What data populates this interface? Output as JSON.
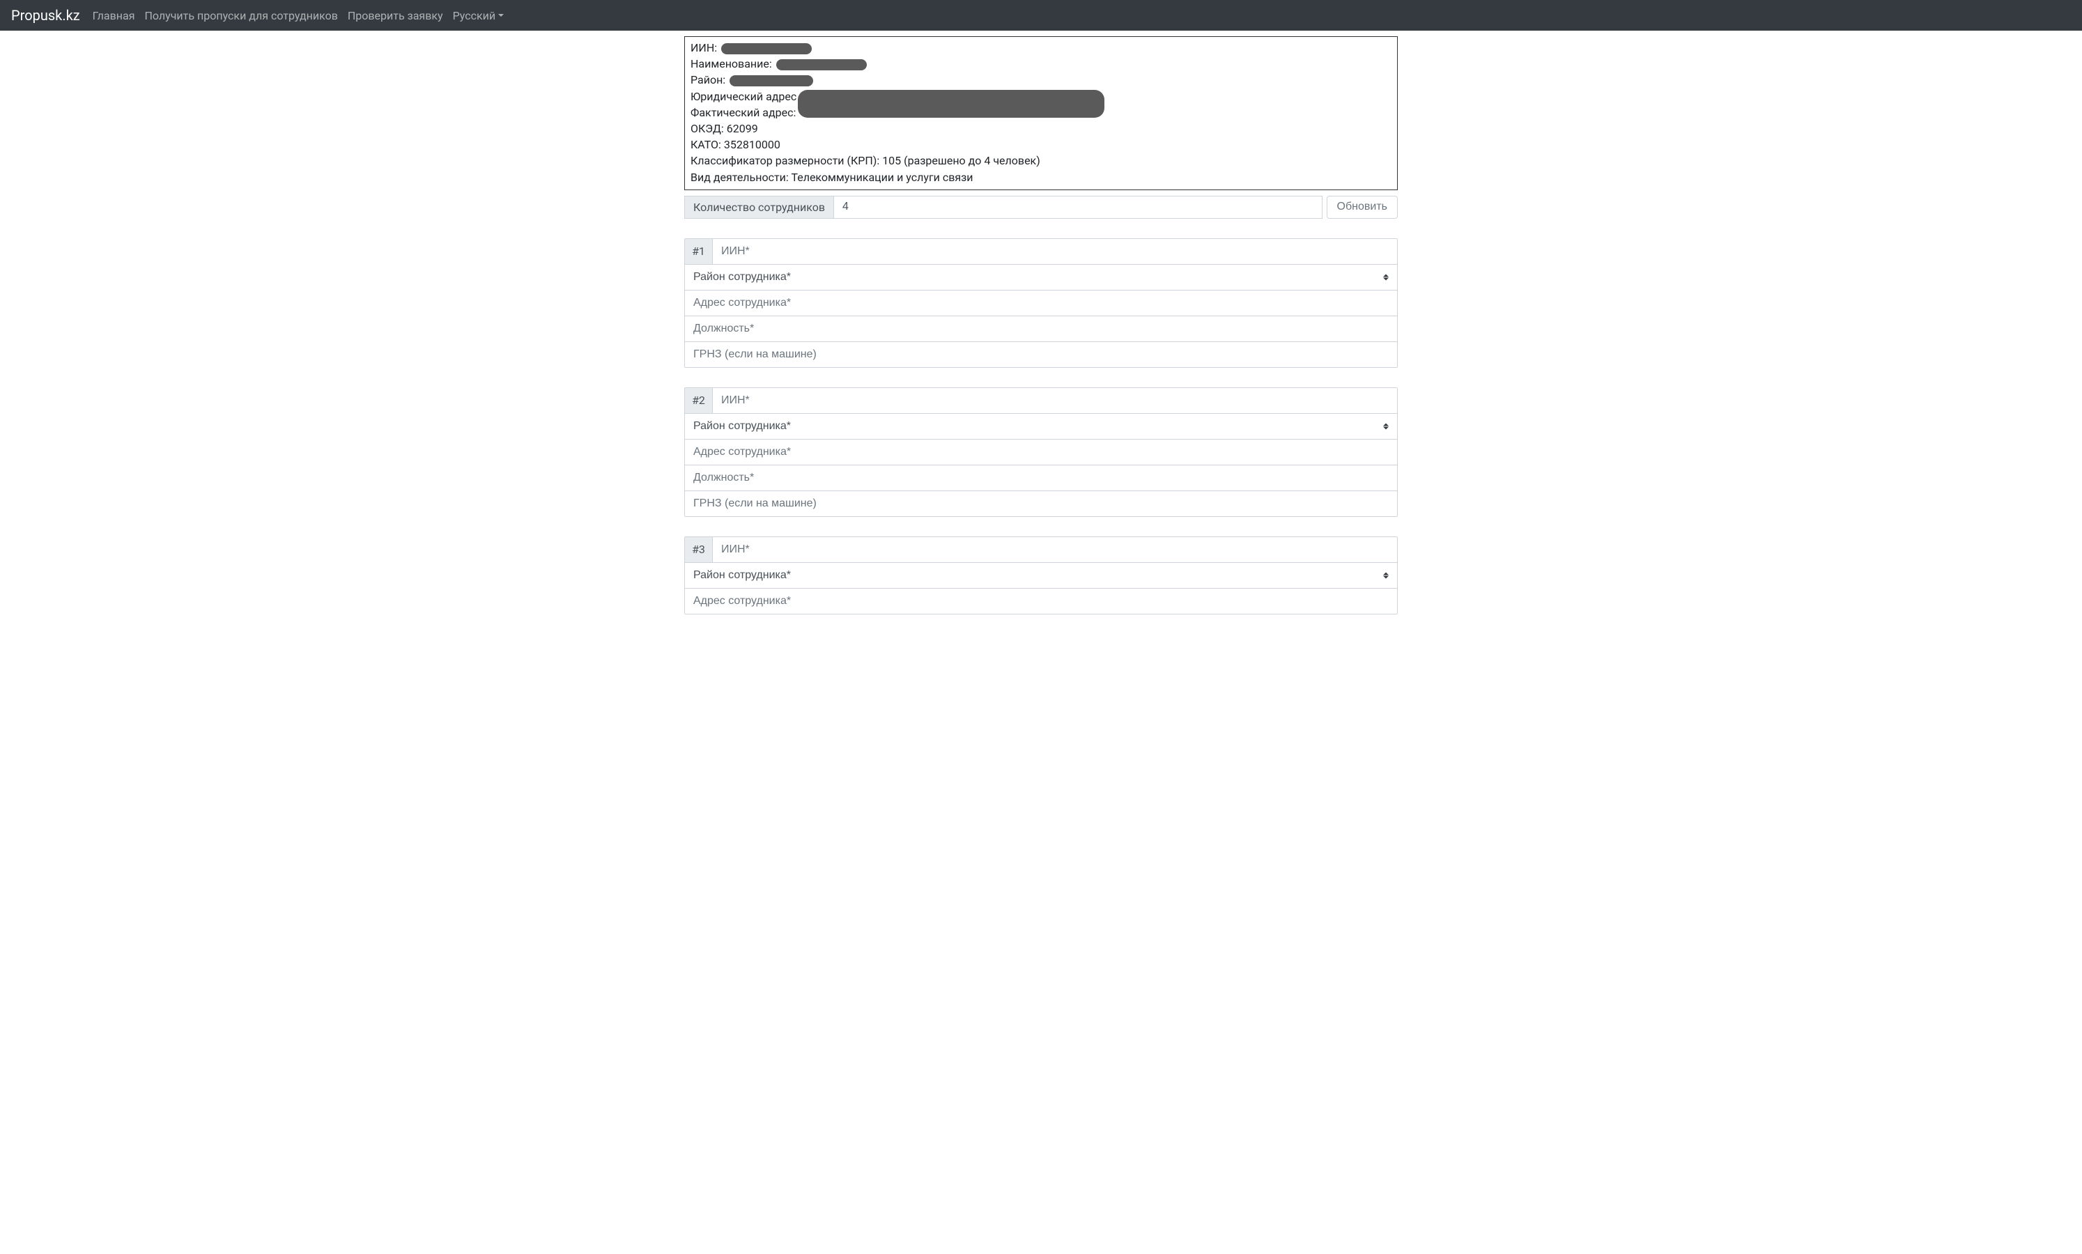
{
  "nav": {
    "brand": "Propusk.kz",
    "home": "Главная",
    "get_pass": "Получить пропуски для сотрудников",
    "check": "Проверить заявку",
    "lang": "Русский"
  },
  "info": {
    "iin_label": "ИИН:",
    "name_label": "Наименование:",
    "district_label": "Район:",
    "legal_addr_label": "Юридический адрес",
    "actual_addr_label": "Фактический адрес:",
    "oked_label": "ОКЭД:",
    "oked_value": "62099",
    "kato_label": "КАТО:",
    "kato_value": "352810000",
    "krp_label": "Классификатор размерности (КРП):",
    "krp_value": "105 (разрешено до 4 человек)",
    "activity_label": "Вид деятельности:",
    "activity_value": "Телекоммуникации и услуги связи"
  },
  "count_block": {
    "label": "Количество сотрудников",
    "value": "4",
    "update": "Обновить"
  },
  "emp_placeholders": {
    "iin": "ИИН*",
    "district": "Район сотрудника*",
    "address": "Адрес сотрудника*",
    "position": "Должность*",
    "grnz": "ГРНЗ (если на машине)"
  },
  "employees": [
    {
      "idx": "#1"
    },
    {
      "idx": "#2"
    },
    {
      "idx": "#3"
    }
  ]
}
